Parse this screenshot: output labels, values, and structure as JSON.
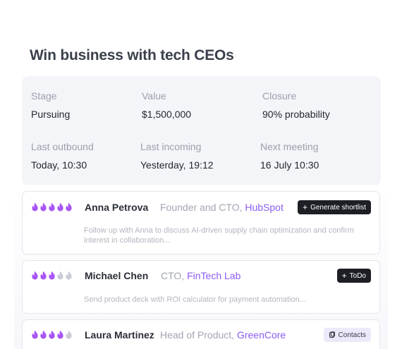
{
  "title": "Win business with tech CEOs",
  "stats": [
    {
      "label": "Stage",
      "value": "Pursuing"
    },
    {
      "label": "Value",
      "value": "$1,500,000"
    },
    {
      "label": "Closure",
      "value": "90% probability"
    },
    {
      "label": "Last outbound",
      "value": "Today, 10:30"
    },
    {
      "label": "Last incoming",
      "value": "Yesterday, 19:12"
    },
    {
      "label": "Next meeting",
      "value": "16 July 10:30"
    }
  ],
  "contacts": [
    {
      "rating": 5,
      "name": "Anna Petrova",
      "role": "Founder and CTO,",
      "company": "HubSpot",
      "action": "Generate shortlist",
      "action_icon": "plus-icon",
      "note": "Follow up with Anna to discuss AI-driven supply chain optimization and confirm interest in collaboration..."
    },
    {
      "rating": 3,
      "name": "Michael Chen",
      "role": "CTO,",
      "company": "FinTech Lab",
      "action": "ToDo",
      "action_icon": "plus-icon",
      "note": "Send product deck with ROI calculator for payment automation..."
    },
    {
      "rating": 4,
      "name": "Laura Martinez",
      "role": "Head of Product,",
      "company": "GreenCore",
      "action": "Contacts",
      "action_icon": "copy-icon",
      "note": ""
    }
  ],
  "colors": {
    "flame_active": "#a855f7",
    "flame_inactive": "#c9ccd4",
    "company": "#8b5cf6"
  }
}
